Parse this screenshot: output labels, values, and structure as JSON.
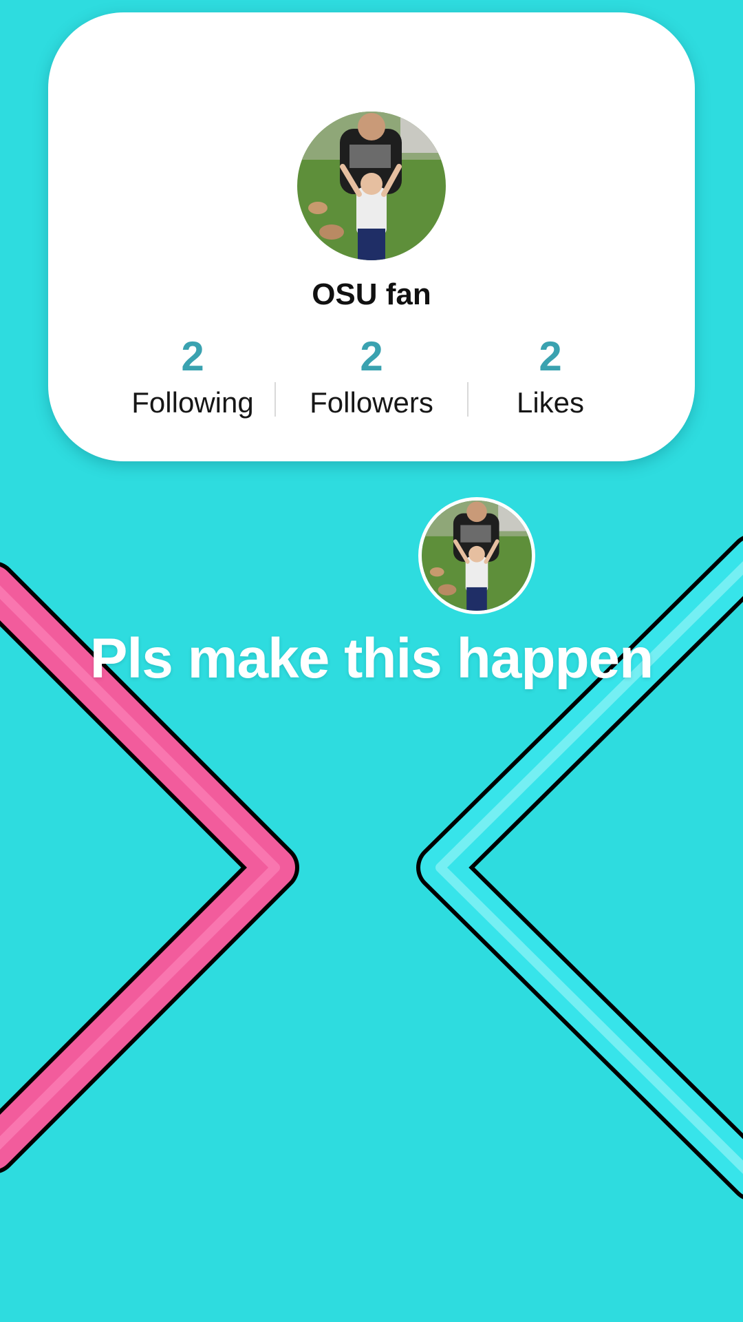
{
  "profile": {
    "username": "OSU fan",
    "avatar_icon": "profile-photo-man-and-toddler",
    "stats": [
      {
        "value": "2",
        "label": "Following"
      },
      {
        "value": "2",
        "label": "Followers"
      },
      {
        "value": "2",
        "label": "Likes"
      }
    ]
  },
  "caption": "Pls make this happen",
  "colors": {
    "background": "#2EDCDF",
    "stat_value": "#3AA2B0",
    "chevron_left": "#F25C9C",
    "chevron_right": "#37E4EA"
  }
}
